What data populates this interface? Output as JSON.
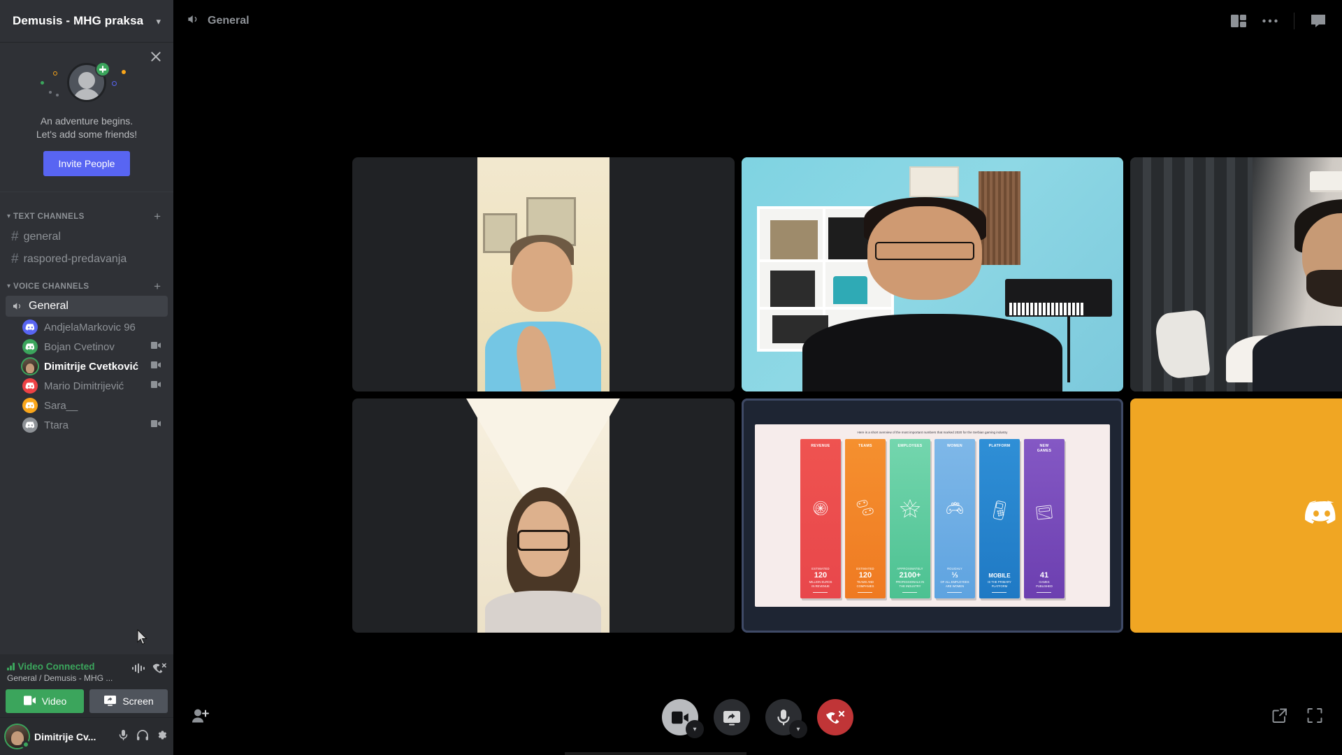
{
  "sidebar": {
    "server_name": "Demusis - MHG praksa",
    "chevron_icon": "chevron-down-icon",
    "invite": {
      "close_icon": "close-icon",
      "line1": "An adventure begins.",
      "line2": "Let's add some friends!",
      "button_label": "Invite People",
      "button_color": "#5865f2"
    },
    "categories": [
      {
        "label": "TEXT CHANNELS",
        "add_icon": "plus-icon"
      },
      {
        "label": "VOICE CHANNELS",
        "add_icon": "plus-icon"
      }
    ],
    "text_channels": [
      {
        "name": "general",
        "icon": "hash-icon"
      },
      {
        "name": "raspored-predavanja",
        "icon": "hash-icon"
      }
    ],
    "voice_channels": [
      {
        "name": "General",
        "icon": "speaker-icon",
        "active": true
      }
    ],
    "members": [
      {
        "name": "AndjelaMarkovic 96",
        "avatar_color": "#5865f2",
        "avatar_type": "discord",
        "has_video": false,
        "speaking": false
      },
      {
        "name": "Bojan Cvetinov",
        "avatar_color": "#3ba55c",
        "avatar_type": "discord",
        "has_video": true,
        "speaking": false
      },
      {
        "name": "Dimitrije Cvetković",
        "avatar_color": "#3ba55c",
        "avatar_type": "photo",
        "has_video": true,
        "speaking": true
      },
      {
        "name": "Mario Dimitrijević",
        "avatar_color": "#ed4245",
        "avatar_type": "discord",
        "has_video": true,
        "speaking": false
      },
      {
        "name": "Sara__",
        "avatar_color": "#faa61a",
        "avatar_type": "discord",
        "has_video": false,
        "speaking": false
      },
      {
        "name": "Ttara",
        "avatar_color": "#8e9297",
        "avatar_type": "discord",
        "has_video": true,
        "speaking": false
      }
    ],
    "voice_status": {
      "title": "Video Connected",
      "title_color": "#3ba55c",
      "subtitle": "General / Demusis - MHG ...",
      "signal_icon": "signal-bars-icon",
      "noise_icon": "noise-suppression-icon",
      "disconnect_icon": "phone-disconnect-icon",
      "video_button": "Video",
      "video_icon": "camera-icon",
      "screen_button": "Screen",
      "screen_icon": "screen-share-icon"
    },
    "user": {
      "name": "Dimitrije Cv...",
      "status": "online",
      "mic_icon": "microphone-icon",
      "headphones_icon": "headphones-icon",
      "settings_icon": "gear-icon"
    }
  },
  "topbar": {
    "channel_icon": "speaker-icon",
    "channel_name": "General",
    "grid_icon": "grid-layout-icon",
    "more_icon": "more-options-icon",
    "chat_icon": "chat-toggle-icon"
  },
  "call": {
    "tiles": [
      {
        "id": "tile-1",
        "kind": "video-portrait",
        "render": "man1",
        "speaking": false
      },
      {
        "id": "tile-2",
        "kind": "video-landscape",
        "render": "man2",
        "speaking": true
      },
      {
        "id": "tile-3",
        "kind": "video-landscape",
        "render": "man3",
        "speaking": false
      },
      {
        "id": "tile-4",
        "kind": "video-portrait",
        "render": "woman",
        "speaking": false
      },
      {
        "id": "tile-5",
        "kind": "screenshare",
        "render": "infographic",
        "speaking": false
      },
      {
        "id": "tile-6",
        "kind": "avatar-placeholder",
        "render": "discord-logo",
        "background": "#f0a623",
        "speaking": false
      }
    ],
    "controls": {
      "add_person_icon": "add-person-icon",
      "camera_icon": "camera-icon",
      "camera_state": "on",
      "camera_caret_icon": "chevron-down-icon",
      "screenshare_icon": "screen-share-icon",
      "microphone_icon": "microphone-icon",
      "microphone_caret_icon": "chevron-down-icon",
      "hangup_icon": "phone-disconnect-icon",
      "hangup_color": "#c03537",
      "popout_icon": "pop-out-icon",
      "fullscreen_icon": "fullscreen-icon"
    }
  },
  "screenshare": {
    "subtitle": "Here is a short overview of the most important numbers that marked 2020 for the Serbian gaming industry",
    "cards": [
      {
        "title": "REVENUE",
        "icon": "coin-icon",
        "pre": "ESTIMATED",
        "big": "120",
        "desc": "MILLION EUROS\nIN REVENUE",
        "color_from": "#ef5350",
        "color_to": "#e8474b"
      },
      {
        "title": "TEAMS",
        "icon": "gamepad-icon",
        "pre": "ESTIMATED",
        "big": "120",
        "desc": "TEAMS AND\nCOMPANIES",
        "color_from": "#f5902f",
        "color_to": "#ef7a22"
      },
      {
        "title": "EMPLOYEES",
        "icon": "star-icon",
        "pre": "APPROXIMATELY",
        "big": "2100+",
        "desc": "PROFESSIONALS IN\nTHE INDUSTRY",
        "color_from": "#74d6ae",
        "color_to": "#4cc191"
      },
      {
        "title": "WOMEN",
        "icon": "controller-icon",
        "pre": "ROUGHLY",
        "big": "⅓",
        "desc": "OF ALL EMPLOYEES\nARE WOMEN",
        "color_from": "#7fb8e8",
        "color_to": "#5ea3e0"
      },
      {
        "title": "PLATFORM",
        "icon": "phone-icon",
        "pre": "",
        "big": "MOBILE",
        "desc": "IS THE PRIMARY\nPLATFORM",
        "color_from": "#2f8fd6",
        "color_to": "#1f79c4"
      },
      {
        "title": "NEW\nGAMES",
        "icon": "cartridge-icon",
        "pre": "",
        "big": "41",
        "desc": "GAMES\nPUBLISHED",
        "color_from": "#8458c4",
        "color_to": "#6c3fb0"
      }
    ]
  }
}
